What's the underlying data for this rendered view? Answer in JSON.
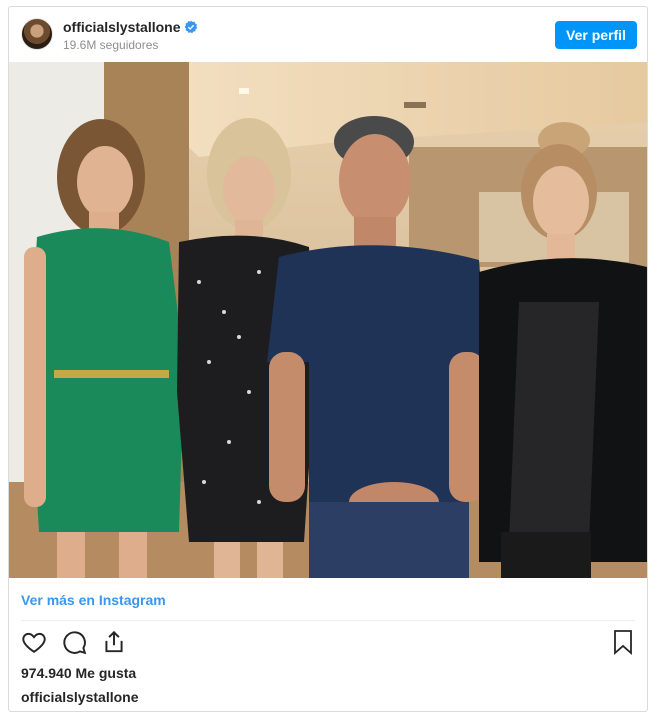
{
  "header": {
    "username": "officialslystallone",
    "followers": "19.6M seguidores",
    "profile_button": "Ver perfil",
    "verified_icon": "verified-badge-icon"
  },
  "photo": {
    "icon": "photo-image"
  },
  "footer": {
    "more_link": "Ver más en Instagram",
    "likes": "974.940 Me gusta",
    "owner": "officialslystallone",
    "action_icons": [
      "heart-icon",
      "comment-icon",
      "share-icon",
      "bookmark-icon"
    ]
  },
  "colors": {
    "accent": "#0095f6",
    "link": "#3897f0",
    "border": "#dbdbdb"
  }
}
